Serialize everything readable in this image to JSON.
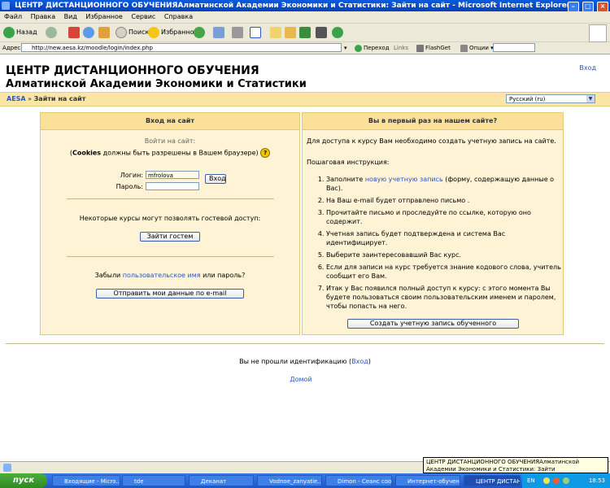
{
  "window": {
    "title": "ЦЕНТР ДИСТАНЦИОННОГО ОБУЧЕНИЯАлматинской Академии Экономики и Статистики: Зайти на сайт - Microsoft Internet Explorer"
  },
  "menu": [
    "Файл",
    "Правка",
    "Вид",
    "Избранное",
    "Сервис",
    "Справка"
  ],
  "toolbar": {
    "back": "Назад",
    "search": "Поиск",
    "favorites": "Избранное"
  },
  "address": {
    "label": "Адрес:",
    "url": "http://new.aesa.kz/moodle/login/index.php",
    "go": "Переход",
    "links": "Links",
    "flashget": "FlashGet",
    "options": "Опции"
  },
  "site": {
    "title_line1": "ЦЕНТР ДИСТАНЦИОННОГО ОБУЧЕНИЯ",
    "title_line2": "Алматинской Академии Экономики и Статистики",
    "login_link": "Вход"
  },
  "breadcrumb": {
    "home": "AESA",
    "separator": "»",
    "current": "Зайти на сайт"
  },
  "language": {
    "selected": "Русский (ru)"
  },
  "login_box": {
    "heading": "Вход на сайт",
    "intro": "Войти на сайт:",
    "cookies_bold": "Cookies",
    "cookies_text": "должны быть разрешены в Вашем браузере)",
    "cookies_open": "(",
    "help_icon": "?",
    "username_label": "Логин:",
    "username_value": "mfrolova",
    "password_label": "Пароль:",
    "login_button": "Вход",
    "guest_text": "Некоторые курсы могут позволять гостевой доступ:",
    "guest_button": "Зайти гостем",
    "forgot_prefix": "Забыли",
    "forgot_link": "пользовательское имя",
    "forgot_suffix": "или пароль?",
    "send_button": "Отправить мои данные по e-mail"
  },
  "signup_box": {
    "heading": "Вы в первый раз на нашем сайте?",
    "intro": "Для доступа к курсу Вам необходимо создать учетную запись на сайте.",
    "steps_title": "Пошаговая инструкция:",
    "step1_prefix": "Заполните",
    "step1_link": "новую учетную запись",
    "step1_suffix": "(форму, содержащую данные о Вас).",
    "step2": "На Ваш e-mail будет отправлено письмо .",
    "step3": "Прочитайте письмо и проследуйте по ссылке, которую оно содержит.",
    "step4": "Учетная запись будет подтверждена и система Вас идентифицирует.",
    "step5": "Выберите заинтересовавший Вас курс.",
    "step6": "Если для записи на курс требуется знание кодового слова, учитель сообщит его Вам.",
    "step7": "Итак у Вас появился полный доступ к курсу: с этого момента Вы будете пользоваться своим пользовательским именем и паролем, чтобы попасть на него.",
    "create_button": "Создать учетную запись обученного"
  },
  "footer": {
    "not_logged": "Вы не прошли идентификацию",
    "login_open": "(",
    "login_link": "Вход",
    "login_close": ")",
    "home_link": "Домой"
  },
  "tooltip": {
    "text": "ЦЕНТР ДИСТАНЦИОННОГО ОБУЧЕНИЯАлматинской Академии Экономики и Статистики: Зайти"
  },
  "taskbar": {
    "start": "пуск",
    "tasks": [
      "Входящие - Micro...",
      "tde",
      "Деканат",
      "Vodnoe_zanyatie....",
      "Dimon - Сеанс сооб...",
      "Интернет-обучен...",
      "ЦЕНТР ДИСТАНЦ..."
    ],
    "lang": "EN",
    "clock": "18:53"
  },
  "colors": {
    "accent_link": "#2b57c0",
    "header_bg": "#fbe09a",
    "box_bg": "#fef3d4"
  }
}
